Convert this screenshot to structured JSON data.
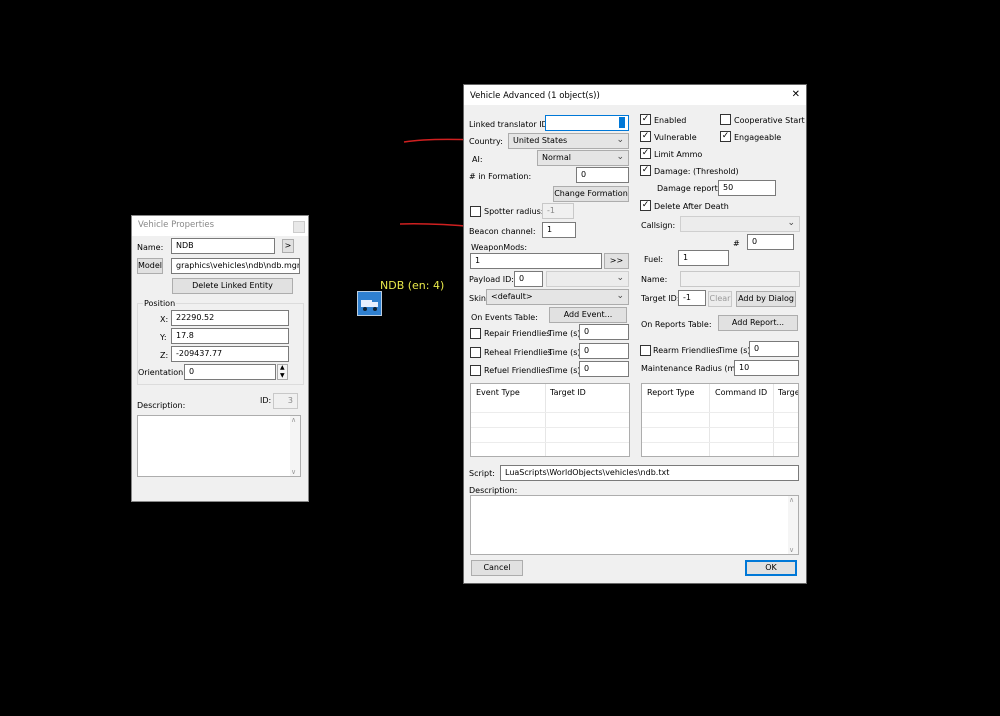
{
  "vehicle_properties": {
    "title": "Vehicle Properties",
    "name_label": "Name:",
    "name_value": "NDB",
    "goto_button": ">",
    "model_button": "Model",
    "model_path": "graphics\\vehicles\\ndb\\ndb.mgm",
    "delete_linked_button": "Delete Linked Entity",
    "position_group": "Position",
    "x_label": "X:",
    "x_value": "22290.52",
    "y_label": "Y:",
    "y_value": "17.8",
    "z_label": "Z:",
    "z_value": "-209437.77",
    "orientation_label": "Orientation:",
    "orientation_value": "0",
    "description_label": "Description:",
    "id_label": "ID:",
    "id_value": "3"
  },
  "map_entity": {
    "label": "NDB (en: 4)",
    "label_color": "#e8e84a",
    "icon": "truck-icon",
    "icon_color": "#2f80d0"
  },
  "annotations": {
    "arrow_color": "#d02020",
    "arrows": [
      "red-arrow-country",
      "red-arrow-beacon-channel"
    ]
  },
  "vehicle_advanced": {
    "title": "Vehicle Advanced (1 object(s))",
    "close_glyph": "✕",
    "linked_translator_label": "Linked translator ID:",
    "linked_translator_value": "",
    "country_label": "Country:",
    "country_value": "United States",
    "ai_label": "AI:",
    "ai_value": "Normal",
    "formation_label": "# in Formation:",
    "formation_value": "0",
    "change_formation_button": "Change Formation",
    "spotter_label": "Spotter radius:",
    "spotter_value": "-1",
    "beacon_label": "Beacon channel:",
    "beacon_value": "1",
    "weaponmods_label": "WeaponMods:",
    "weaponmods_value": "1",
    "weaponmods_button": ">>",
    "payload_label": "Payload ID:",
    "payload_value": "0",
    "skin_label": "Skin:",
    "skin_value": "<default>",
    "on_events_label": "On Events Table:",
    "add_event_button": "Add Event...",
    "repair_label": "Repair Friendlies",
    "reheal_label": "Reheal Friendlies",
    "refuel_label": "Refuel Friendlies",
    "time_label": "Time (s):",
    "repair_time": "0",
    "reheal_time": "0",
    "refuel_time": "0",
    "events_columns": [
      "Event Type",
      "Target ID"
    ],
    "enabled_label": "Enabled",
    "enabled_checked": true,
    "coop_label": "Cooperative Start",
    "coop_checked": false,
    "vulnerable_label": "Vulnerable",
    "vulnerable_checked": true,
    "engageable_label": "Engageable",
    "engageable_checked": true,
    "limit_ammo_label": "Limit Ammo",
    "limit_ammo_checked": true,
    "damage_label": "Damage: (Threshold)",
    "damage_checked": true,
    "damage_report_label": "Damage report:",
    "damage_report_value": "50",
    "delete_after_death_label": "Delete After Death",
    "delete_after_death_checked": true,
    "callsign_label": "Callsign:",
    "hash_label": "#",
    "hash_value": "0",
    "fuel_label": "Fuel:",
    "fuel_value": "1",
    "name_label": "Name:",
    "target_id_label": "Target ID:",
    "target_id_value": "-1",
    "clear_button": "Clear",
    "add_by_dialog_button": "Add by Dialog",
    "on_reports_label": "On Reports Table:",
    "add_report_button": "Add Report...",
    "rearm_label": "Rearm Friendlies",
    "rearm_time": "0",
    "maint_label": "Maintenance Radius (m):",
    "maint_value": "10",
    "reports_columns": [
      "Report Type",
      "Command ID",
      "Targe"
    ],
    "script_label": "Script:",
    "script_value": "LuaScripts\\WorldObjects\\vehicles\\ndb.txt",
    "description_label": "Description:",
    "cancel_button": "Cancel",
    "ok_button": "OK"
  }
}
